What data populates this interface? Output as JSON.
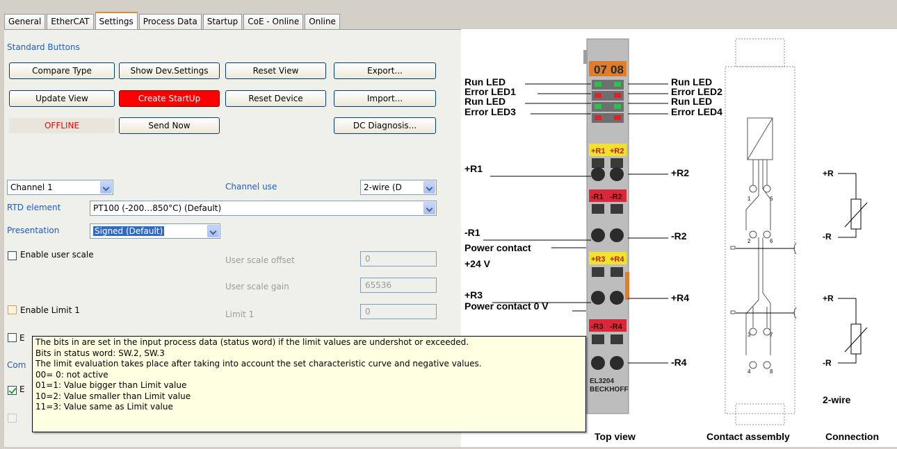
{
  "tabs": [
    "General",
    "EtherCAT",
    "Settings",
    "Process Data",
    "Startup",
    "CoE - Online",
    "Online"
  ],
  "standard_buttons": {
    "heading": "Standard Buttons",
    "compare_type": "Compare Type",
    "show_dev_settings": "Show Dev.Settings",
    "reset_view": "Reset View",
    "export": "Export...",
    "update_view": "Update View",
    "create_startup": "Create StartUp",
    "reset_device": "Reset Device",
    "import": "Import...",
    "offline": "OFFLINE",
    "send_now": "Send Now",
    "dc_diagnosis": "DC Diagnosis..."
  },
  "settings": {
    "channel": "Channel 1",
    "channel_use_label": "Channel use",
    "channel_use_value": "2-wire (D",
    "rtd_label": "RTD element",
    "rtd_value": "PT100 (-200…850°C) (Default)",
    "presentation_label": "Presentation",
    "presentation_value": "Signed (Default)",
    "enable_user_scale": "Enable user scale",
    "user_scale_offset_label": "User scale offset",
    "user_scale_offset_value": "0",
    "user_scale_gain_label": "User scale gain",
    "user_scale_gain_value": "65536",
    "enable_limit1": "Enable Limit 1",
    "limit1_label": "Limit 1",
    "limit1_value": "0",
    "partial_e": "E",
    "partial_com": "Com",
    "partial_e2": "E"
  },
  "tooltip": {
    "lines": [
      "The bits in are set in the input process data (status word) if the limit values are undershot or exceeded.",
      "Bits in status word: SW.2, SW.3",
      "The limit evaluation takes place after taking into account the set characteristic curve and negative values.",
      "00= 0: not active",
      "01=1: Value bigger than Limit value",
      "10=2: Value smaller than Limit value",
      "11=3: Value same as Limit value"
    ]
  },
  "diagram": {
    "terminal_top_labels": [
      "07",
      "08"
    ],
    "left_labels": [
      "Run LED",
      "Error LED1",
      "Run LED",
      "Error LED3",
      "+R1",
      "-R1",
      "Power contact",
      "+24 V",
      "+R3",
      "Power contact 0 V"
    ],
    "right_labels": [
      "Run LED",
      "Error LED2",
      "Run LED",
      "Error LED4",
      "+R2",
      "-R2",
      "+R4",
      "-R4"
    ],
    "terminal_marks": [
      "+R1",
      "+R2",
      "-R1",
      "-R2",
      "+R3",
      "+R4",
      "-R3",
      "-R4"
    ],
    "device_model": "EL3204",
    "brand": "BECKHOFF",
    "contact_numbers": [
      "1",
      "5",
      "2",
      "6",
      "3",
      "7",
      "4",
      "8"
    ],
    "connection_labels": [
      "+R",
      "-R",
      "+R",
      "-R"
    ],
    "wire_label": "2-wire",
    "captions": [
      "Top view",
      "Contact assembly",
      "Connection"
    ]
  },
  "colors": {
    "accent_tab": "#e68b2c",
    "create_startup_bg": "#ff0000",
    "offline_text": "#ff0000",
    "label_blue": "#1c5cc9",
    "tooltip_bg": "#ffffe1"
  }
}
